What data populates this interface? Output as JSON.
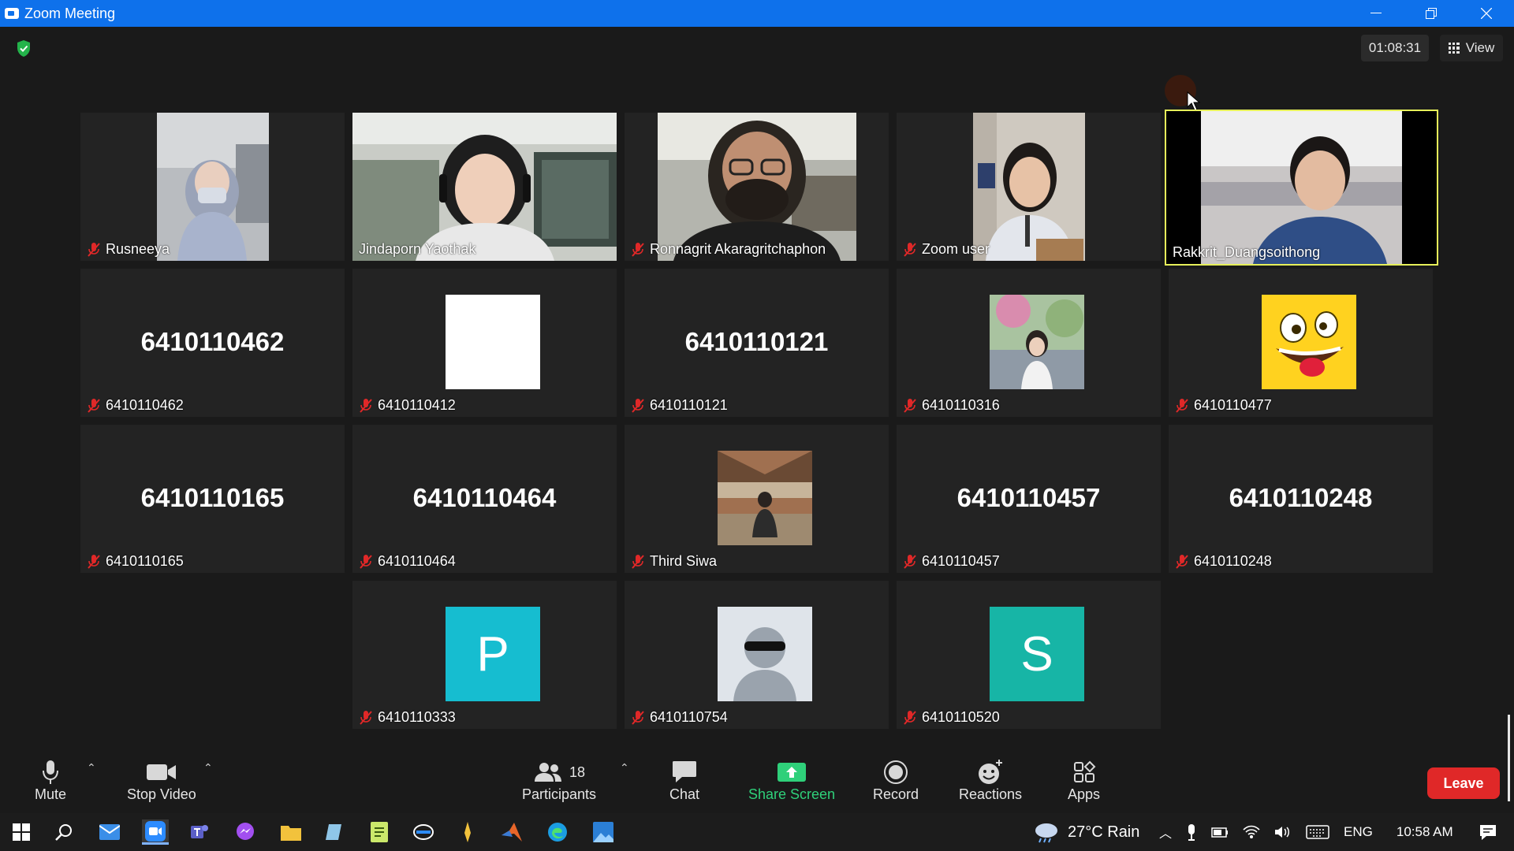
{
  "window": {
    "title": "Zoom Meeting"
  },
  "meeting": {
    "timer": "01:08:31",
    "view_label": "View"
  },
  "tiles": [
    {
      "name": "Rusneeya"
    },
    {
      "name": "Jindaporn Yaothak"
    },
    {
      "name": "Ronnagrit Akaragritchaphon"
    },
    {
      "name": "Zoom user"
    },
    {
      "name": "Rakkrit_Duangsoithong"
    },
    {
      "name": "6410110462",
      "display": "6410110462"
    },
    {
      "name": "6410110412"
    },
    {
      "name": "6410110121",
      "display": "6410110121"
    },
    {
      "name": "6410110316"
    },
    {
      "name": "6410110477"
    },
    {
      "name": "6410110165",
      "display": "6410110165"
    },
    {
      "name": "6410110464",
      "display": "6410110464"
    },
    {
      "name": "Third Siwa"
    },
    {
      "name": "6410110457",
      "display": "6410110457"
    },
    {
      "name": "6410110248",
      "display": "6410110248"
    },
    {
      "name": "6410110333",
      "letter": "P"
    },
    {
      "name": "6410110754"
    },
    {
      "name": "6410110520",
      "letter": "S"
    }
  ],
  "toolbar": {
    "mute": "Mute",
    "stop_video": "Stop Video",
    "participants": "Participants",
    "participants_count": "18",
    "chat": "Chat",
    "share_screen": "Share Screen",
    "record": "Record",
    "reactions": "Reactions",
    "apps": "Apps",
    "leave": "Leave"
  },
  "taskbar": {
    "weather": "27°C  Rain",
    "language": "ENG",
    "time": "10:58 AM"
  },
  "colors": {
    "title_bar": "#0e71eb",
    "active_speaker": "#e6f05a",
    "share": "#2fd07a",
    "leave": "#e02828",
    "mic_off": "#e02828"
  }
}
